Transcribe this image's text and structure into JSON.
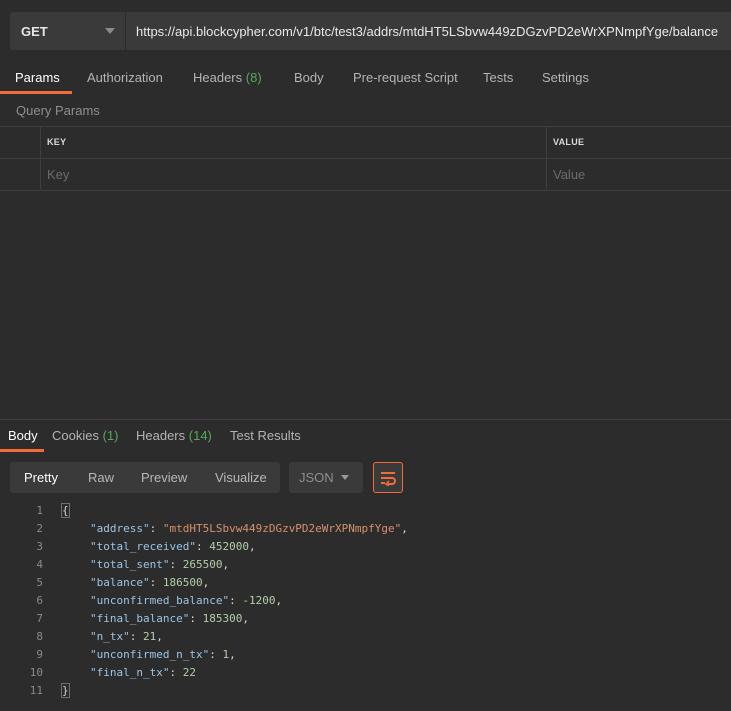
{
  "request": {
    "method": "GET",
    "url": "https://api.blockcypher.com/v1/btc/test3/addrs/mtdHT5LSbvw449zDGzvPD2eWrXPNmpfYge/balance"
  },
  "request_tabs": [
    {
      "label": "Params",
      "count": ""
    },
    {
      "label": "Authorization",
      "count": ""
    },
    {
      "label": "Headers",
      "count": "(8)"
    },
    {
      "label": "Body",
      "count": ""
    },
    {
      "label": "Pre-request Script",
      "count": ""
    },
    {
      "label": "Tests",
      "count": ""
    },
    {
      "label": "Settings",
      "count": ""
    }
  ],
  "query_params": {
    "section_label": "Query Params",
    "key_header": "KEY",
    "value_header": "VALUE",
    "key_placeholder": "Key",
    "value_placeholder": "Value"
  },
  "response_tabs": [
    {
      "label": "Body",
      "count": ""
    },
    {
      "label": "Cookies",
      "count": "(1)"
    },
    {
      "label": "Headers",
      "count": "(14)"
    },
    {
      "label": "Test Results",
      "count": ""
    }
  ],
  "view_modes": [
    "Pretty",
    "Raw",
    "Preview",
    "Visualize"
  ],
  "format": "JSON",
  "icons": {
    "dropdown": "chevron-down-icon",
    "wrap": "wrap-lines-icon"
  },
  "colors": {
    "accent": "#f26b3a",
    "count": "#57a857"
  },
  "response_lines": [
    {
      "n": "1",
      "key": "",
      "value": "",
      "type": "open"
    },
    {
      "n": "2",
      "key": "\"address\"",
      "value": "\"mtdHT5LSbvw449zDGzvPD2eWrXPNmpfYge\"",
      "type": "str"
    },
    {
      "n": "3",
      "key": "\"total_received\"",
      "value": "452000",
      "type": "num"
    },
    {
      "n": "4",
      "key": "\"total_sent\"",
      "value": "265500",
      "type": "num"
    },
    {
      "n": "5",
      "key": "\"balance\"",
      "value": "186500",
      "type": "num"
    },
    {
      "n": "6",
      "key": "\"unconfirmed_balance\"",
      "value": "-1200",
      "type": "num"
    },
    {
      "n": "7",
      "key": "\"final_balance\"",
      "value": "185300",
      "type": "num"
    },
    {
      "n": "8",
      "key": "\"n_tx\"",
      "value": "21",
      "type": "num"
    },
    {
      "n": "9",
      "key": "\"unconfirmed_n_tx\"",
      "value": "1",
      "type": "num"
    },
    {
      "n": "10",
      "key": "\"final_n_tx\"",
      "value": "22",
      "type": "num_last"
    },
    {
      "n": "11",
      "key": "",
      "value": "",
      "type": "close"
    }
  ]
}
